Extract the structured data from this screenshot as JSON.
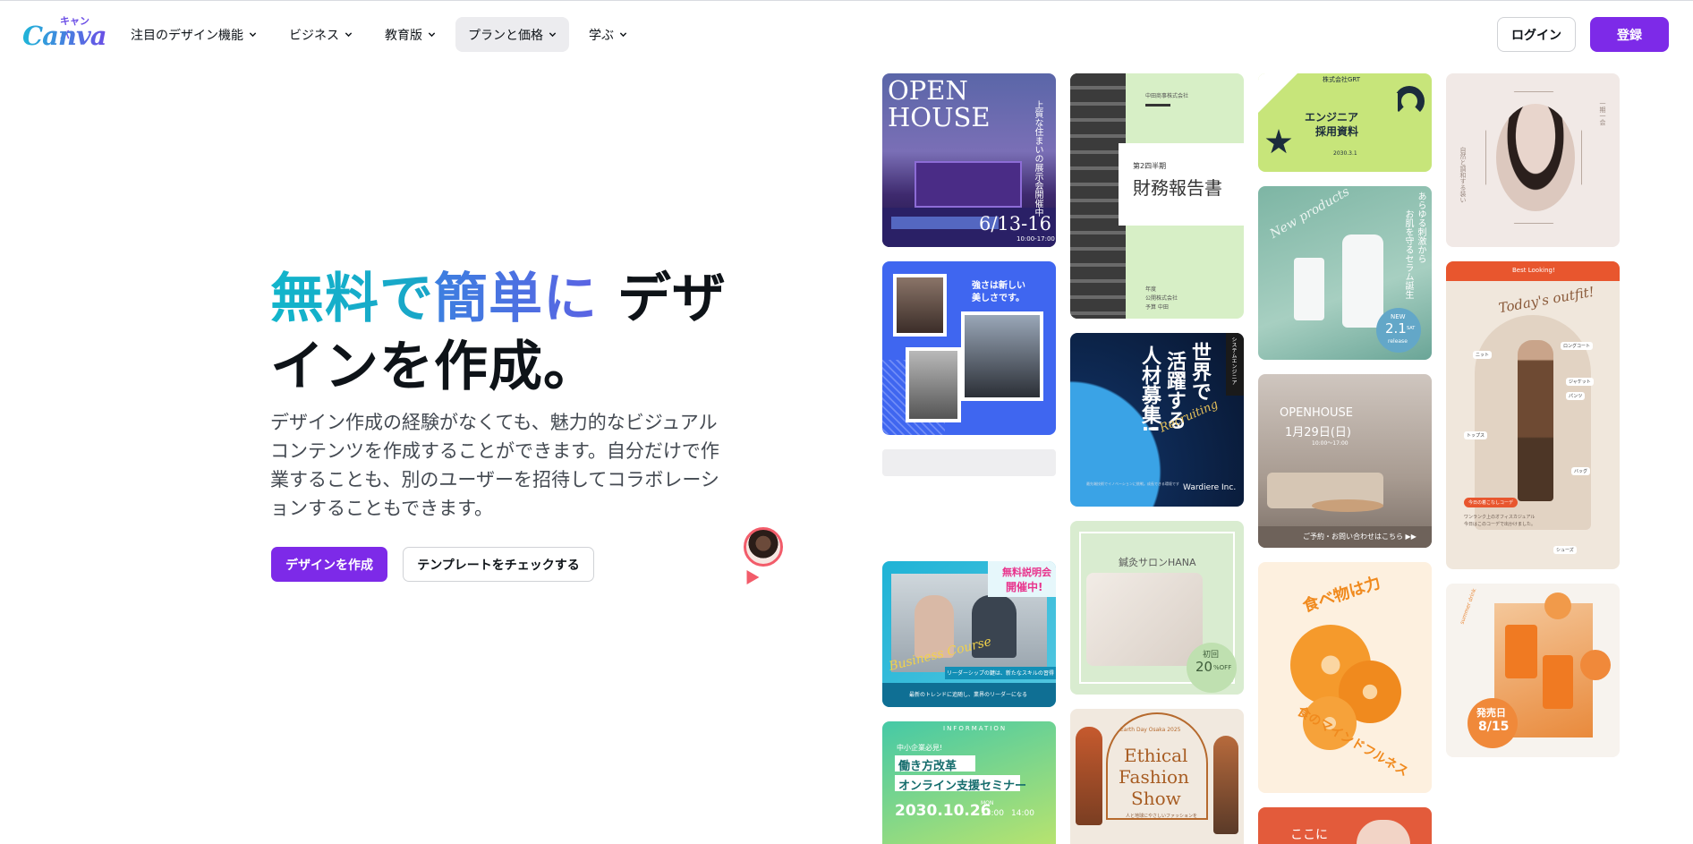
{
  "header": {
    "logo_text": "Canva",
    "logo_kana": "キャンバ",
    "nav": [
      {
        "label": "注目のデザイン機能"
      },
      {
        "label": "ビジネス"
      },
      {
        "label": "教育版"
      },
      {
        "label": "プランと価格"
      },
      {
        "label": "学ぶ"
      }
    ],
    "login_label": "ログイン",
    "register_label": "登録"
  },
  "hero": {
    "title_part1": "無料で",
    "title_part2": "簡単に",
    "title_part3": "デザ",
    "title_part4": "インを作成。",
    "description": "デザイン作成の経験がなくても、魅力的なビジュアルコンテンツを作成することができます。自分だけで作業することも、別のユーザーを招待してコラボレーションすることもできます。",
    "create_button": "デザインを作成",
    "template_button": "テンプレートをチェックする"
  },
  "templates": {
    "openhouse": {
      "title1": "OPEN",
      "title2": "HOUSE",
      "vertical": "上質な住まいの展示会開催中",
      "date": "6/13-16",
      "time": "10:00-17:00"
    },
    "finance": {
      "company": "中田商事株式会社",
      "period": "第2四半期",
      "title": "財務報告書",
      "footer1": "年度",
      "footer2": "公開株式会社",
      "footer3": "予算 中田"
    },
    "engineer": {
      "company": "株式会社GRT",
      "title1": "エンジニア",
      "title2": "採用資料",
      "date": "2030.3.1"
    },
    "fashion_portrait": {
      "vertical1": "一期一会",
      "vertical2": "自然と調和する装い"
    },
    "fitness": {
      "caption1": "強さは新しい",
      "caption2": "美しさです。"
    },
    "recruit": {
      "side": "システムエンジニア",
      "title1": "世界で",
      "title2": "活躍する",
      "title3": "人材募集!",
      "script": "Recruiting",
      "company": "Wardiere Inc.",
      "desc": "最先端技術でイノベーションに挑戦。成長できる環境です"
    },
    "product": {
      "script": "New products",
      "vertical1": "あらゆる刺激から",
      "vertical2": "お肌を守るセラム誕生",
      "new": "NEW",
      "date": "2.1",
      "weekday": "SAT",
      "release": "release"
    },
    "outfit": {
      "top": "Best Looking!",
      "script": "Today's outfit!",
      "tags": [
        "ロングコート",
        "ニット",
        "ジャケット",
        "パンツ",
        "トップス",
        "バッグ",
        "シューズ"
      ],
      "badge": "今日の着こなしコーデ",
      "note1": "ワンランク上のオフィスカジュアル",
      "note2": "今日はこのコーデで出かけました。"
    },
    "openhouse2": {
      "title": "OPENHOUSE",
      "date": "1月29日(日)",
      "time": "10:00～17:00",
      "footer": "ご予約・お問い合わせはこちら ▶▶"
    },
    "business": {
      "tag1": "無料説明会",
      "tag2": "開催中!",
      "script": "Business Course",
      "line1": "リーダーシップの鍵は、新たなスキルの習得",
      "line2": "最新のトレンドに追随し、業界のリーダーになる"
    },
    "salon": {
      "name": "鍼灸サロンHANA",
      "badge1": "初回",
      "badge2": "20",
      "badge3": "%OFF"
    },
    "food": {
      "vertical": "食べ物は力",
      "arc": "食のマインドフルネス"
    },
    "drink": {
      "release": "発売日",
      "date": "8/15",
      "arc": "summer drink"
    },
    "seminar": {
      "info": "INFORMATION",
      "line1": "中小企業必見!",
      "line2": "働き方改革",
      "line3": "オンライン支援セミナー",
      "date": "2030.10.26",
      "weekday": "MON",
      "time1": "13:00",
      "time2": "14:00"
    },
    "ethical": {
      "top": "Earth Day Osaka 2025",
      "title1": "Ethical",
      "title2": "Fashion",
      "title3": "Show",
      "sub": "人と地球にやさしいファッションを"
    },
    "bottom": {
      "text": "ここに"
    }
  }
}
